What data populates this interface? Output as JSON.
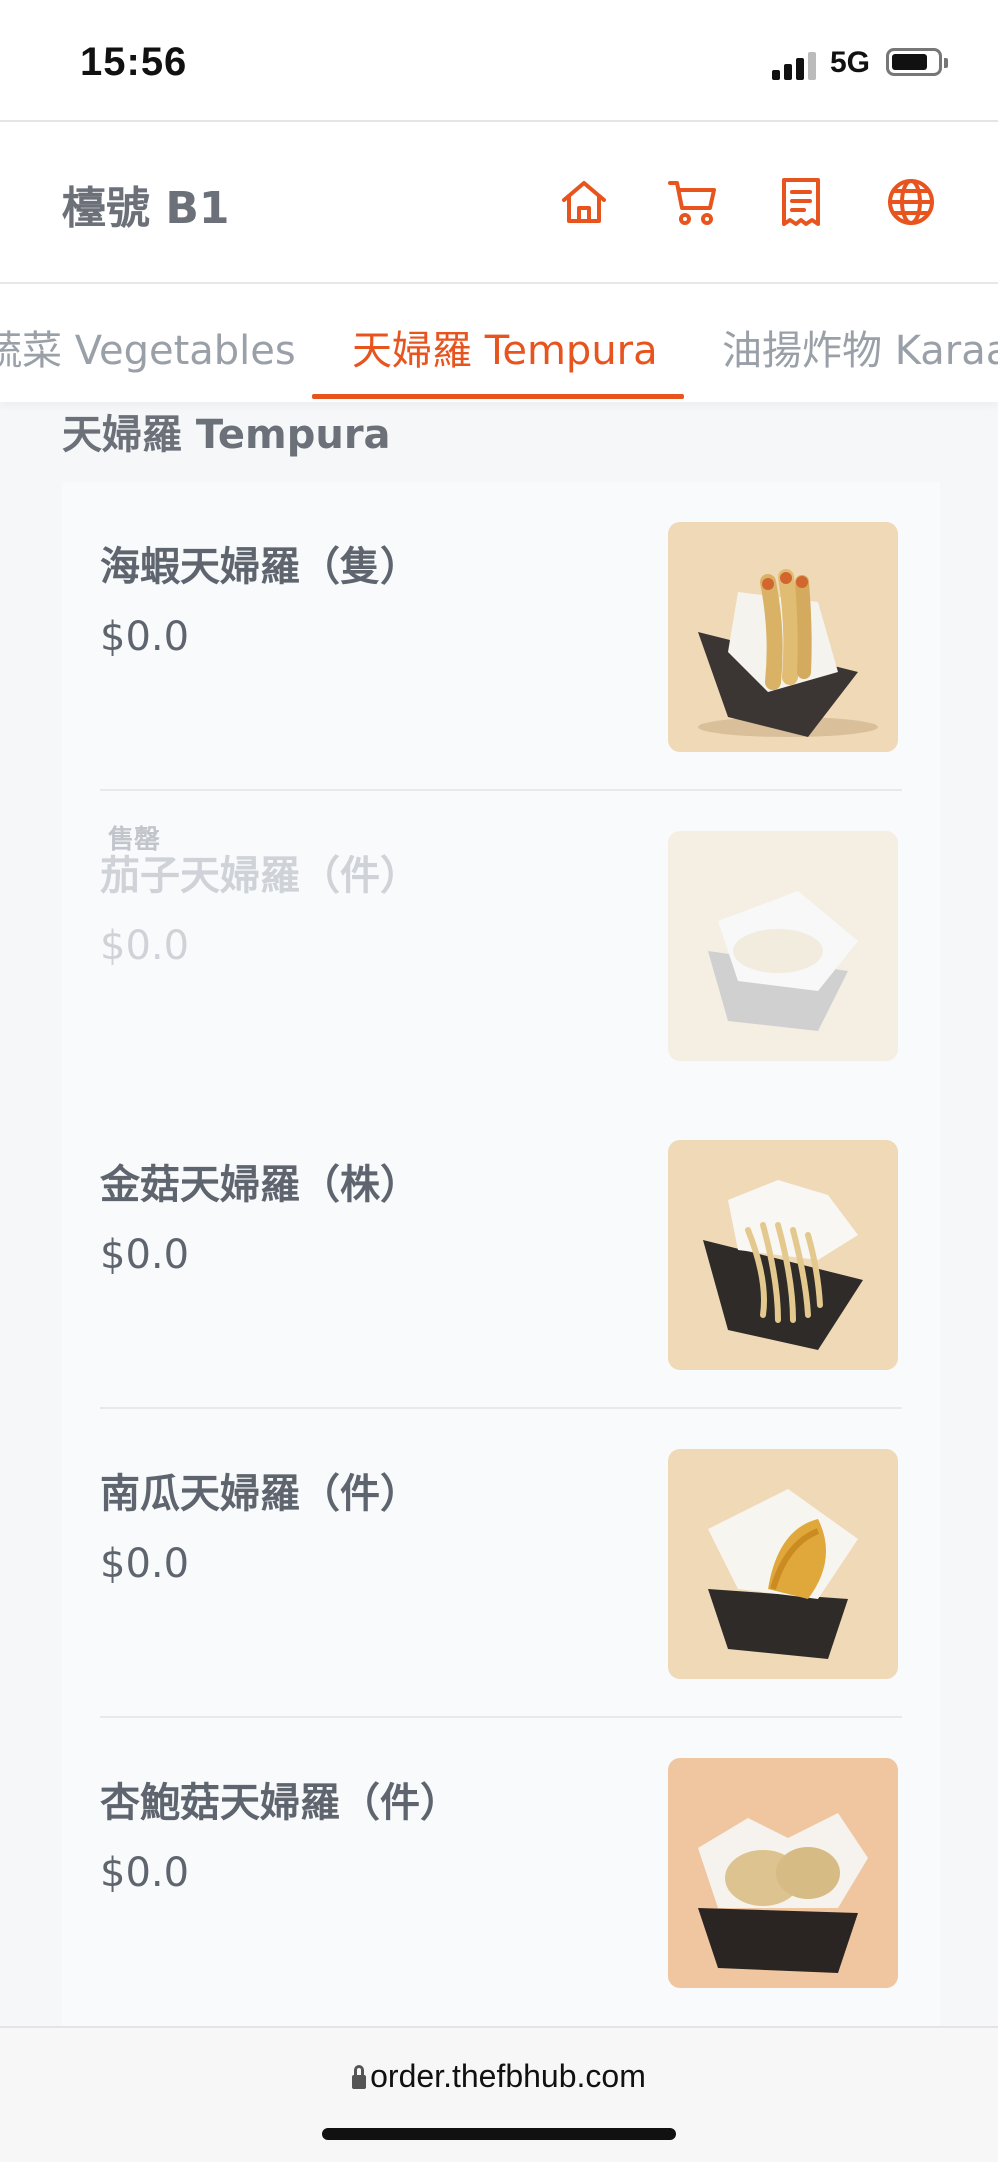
{
  "status_bar": {
    "time": "15:56",
    "network": "5G",
    "battery_level": 0.8
  },
  "header": {
    "title": "檯號 B1",
    "icons": [
      "home-icon",
      "cart-icon",
      "receipt-icon",
      "globe-icon"
    ],
    "accent_color": "#e8541e"
  },
  "tabs": [
    {
      "label": "蔬菜 Vegetables",
      "active": false
    },
    {
      "label": "天婦羅 Tempura",
      "active": true
    },
    {
      "label": "油揚炸物 Karaa",
      "active": false
    }
  ],
  "section": {
    "title": "天婦羅 Tempura"
  },
  "items": [
    {
      "name": "海蝦天婦羅（隻）",
      "price": "$0.0",
      "sold_out": false,
      "badge": ""
    },
    {
      "name": "茄子天婦羅（件）",
      "price": "$0.0",
      "sold_out": true,
      "badge": "售罄"
    },
    {
      "name": "金菇天婦羅（株）",
      "price": "$0.0",
      "sold_out": false,
      "badge": ""
    },
    {
      "name": "南瓜天婦羅（件）",
      "price": "$0.0",
      "sold_out": false,
      "badge": ""
    },
    {
      "name": "杏鮑菇天婦羅（件）",
      "price": "$0.0",
      "sold_out": false,
      "badge": ""
    }
  ],
  "browser": {
    "url": "order.thefbhub.com"
  }
}
